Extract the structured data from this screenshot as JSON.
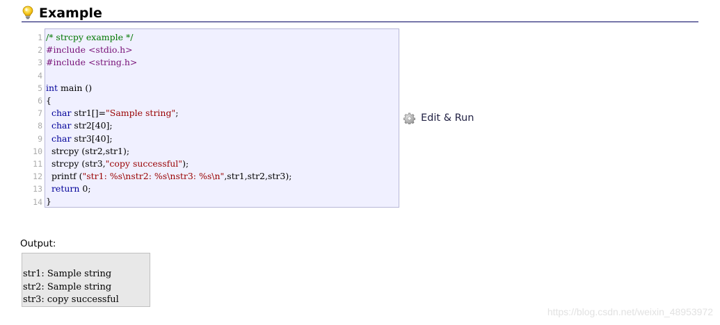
{
  "section": {
    "title": "Example",
    "icon": "lightbulb-icon"
  },
  "code": {
    "line_numbers": [
      "1",
      "2",
      "3",
      "4",
      "5",
      "6",
      "7",
      "8",
      "9",
      "10",
      "11",
      "12",
      "13",
      "14"
    ],
    "lines": [
      [
        {
          "t": "/* strcpy example */",
          "c": "cmt"
        }
      ],
      [
        {
          "t": "#include <stdio.h>",
          "c": "pp"
        }
      ],
      [
        {
          "t": "#include <string.h>",
          "c": "pp"
        }
      ],
      [],
      [
        {
          "t": "int",
          "c": "kw"
        },
        {
          "t": " main ()",
          "c": ""
        }
      ],
      [
        {
          "t": "{",
          "c": ""
        }
      ],
      [
        {
          "t": "  ",
          "c": ""
        },
        {
          "t": "char",
          "c": "kw"
        },
        {
          "t": " str1[]=",
          "c": ""
        },
        {
          "t": "\"Sample string\"",
          "c": "str"
        },
        {
          "t": ";",
          "c": ""
        }
      ],
      [
        {
          "t": "  ",
          "c": ""
        },
        {
          "t": "char",
          "c": "kw"
        },
        {
          "t": " str2[40];",
          "c": ""
        }
      ],
      [
        {
          "t": "  ",
          "c": ""
        },
        {
          "t": "char",
          "c": "kw"
        },
        {
          "t": " str3[40];",
          "c": ""
        }
      ],
      [
        {
          "t": "  strcpy (str2,str1);",
          "c": ""
        }
      ],
      [
        {
          "t": "  strcpy (str3,",
          "c": ""
        },
        {
          "t": "\"copy successful\"",
          "c": "str"
        },
        {
          "t": ");",
          "c": ""
        }
      ],
      [
        {
          "t": "  printf (",
          "c": ""
        },
        {
          "t": "\"str1: %s\\nstr2: %s\\nstr3: %s\\n\"",
          "c": "str"
        },
        {
          "t": ",str1,str2,str3);",
          "c": ""
        }
      ],
      [
        {
          "t": "  ",
          "c": ""
        },
        {
          "t": "return",
          "c": "kw"
        },
        {
          "t": " 0;",
          "c": ""
        }
      ],
      [
        {
          "t": "}",
          "c": ""
        }
      ]
    ]
  },
  "edit_run": {
    "label": "Edit & Run",
    "icon": "gear-icon"
  },
  "output": {
    "label": "Output:",
    "lines": [
      "str1: Sample string",
      "str2: Sample string",
      "str3: copy successful"
    ]
  },
  "watermark": "https://blog.csdn.net/weixin_48953972",
  "colors": {
    "header_rule": "#000060",
    "code_bg": "#f0f0ff",
    "code_border": "#b8b8d8",
    "keyword": "#000099",
    "string": "#990000",
    "comment": "#007700",
    "preprocessor": "#771177",
    "output_bg": "#e8e8e8"
  }
}
